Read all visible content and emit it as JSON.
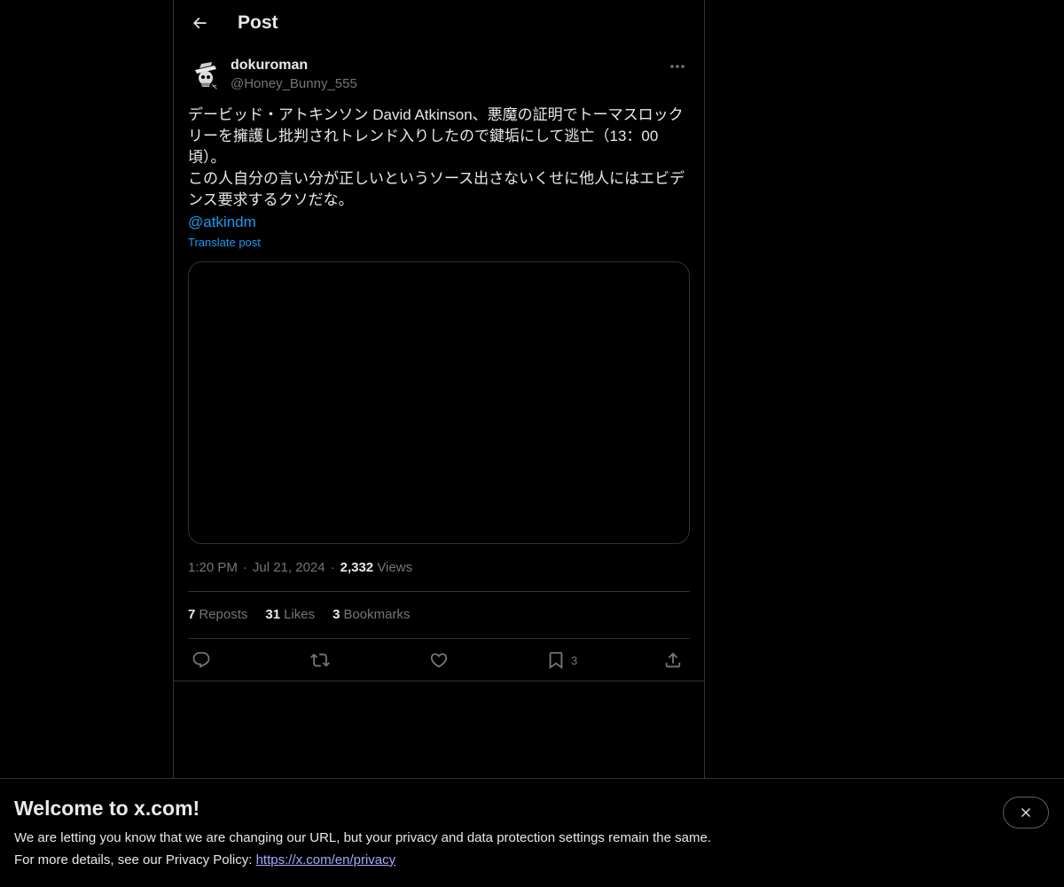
{
  "header": {
    "title": "Post"
  },
  "author": {
    "display_name": "dokuroman",
    "handle": "@Honey_Bunny_555"
  },
  "post": {
    "text": "デービッド・アトキンソン David Atkinson、悪魔の証明でトーマスロックリーを擁護し批判されトレンド入りしたので鍵垢にして逃亡（13：00頃）。\nこの人自分の言い分が正しいというソース出さないくせに他人にはエビデンス要求するクソだな。",
    "mention": "@atkindm",
    "translate_label": "Translate post"
  },
  "meta": {
    "time": "1:20 PM",
    "separator": "·",
    "date": "Jul 21, 2024",
    "views_count": "2,332",
    "views_label": "Views"
  },
  "stats": {
    "reposts_count": "7",
    "reposts_label": "Reposts",
    "likes_count": "31",
    "likes_label": "Likes",
    "bookmarks_count": "3",
    "bookmarks_label": "Bookmarks"
  },
  "actions": {
    "bookmark_count": "3",
    "icons": [
      "reply-icon",
      "repost-icon",
      "like-icon",
      "bookmark-icon",
      "share-icon"
    ]
  },
  "banner": {
    "title": "Welcome to x.com!",
    "line1": "We are letting you know that we are changing our URL, but your privacy and data protection settings remain the same.",
    "line2_prefix": "For more details, see our Privacy Policy: ",
    "link": "https://x.com/en/privacy"
  },
  "colors": {
    "background": "#000000",
    "text_primary": "#e7e9ea",
    "text_secondary": "#71767b",
    "accent_blue": "#1d9bf0",
    "border": "#2f3336",
    "banner_link": "#a7a7ff"
  }
}
